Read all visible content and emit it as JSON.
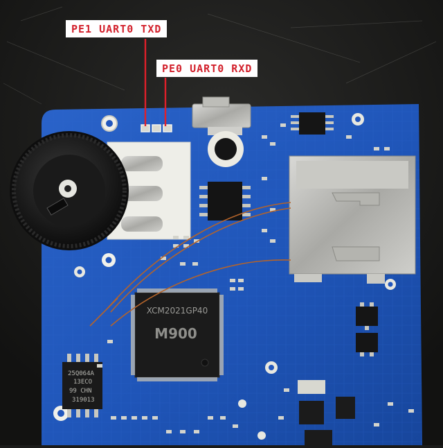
{
  "annotations": {
    "tx_label": "PE1 UART0 TXD",
    "rx_label": "PE0 UART0 RXD",
    "label_text_color": "#d2202b",
    "label_background": "#ffffff",
    "leader_line_color": "#e0202a"
  },
  "board": {
    "pcb_color": "#1f55b8",
    "chip_marking_line1": "XCM2021GP40",
    "chip_marking_line2": "M900",
    "flash_marking": [
      "25Q064A",
      "13ECO",
      "99 CHN",
      "319013"
    ]
  }
}
